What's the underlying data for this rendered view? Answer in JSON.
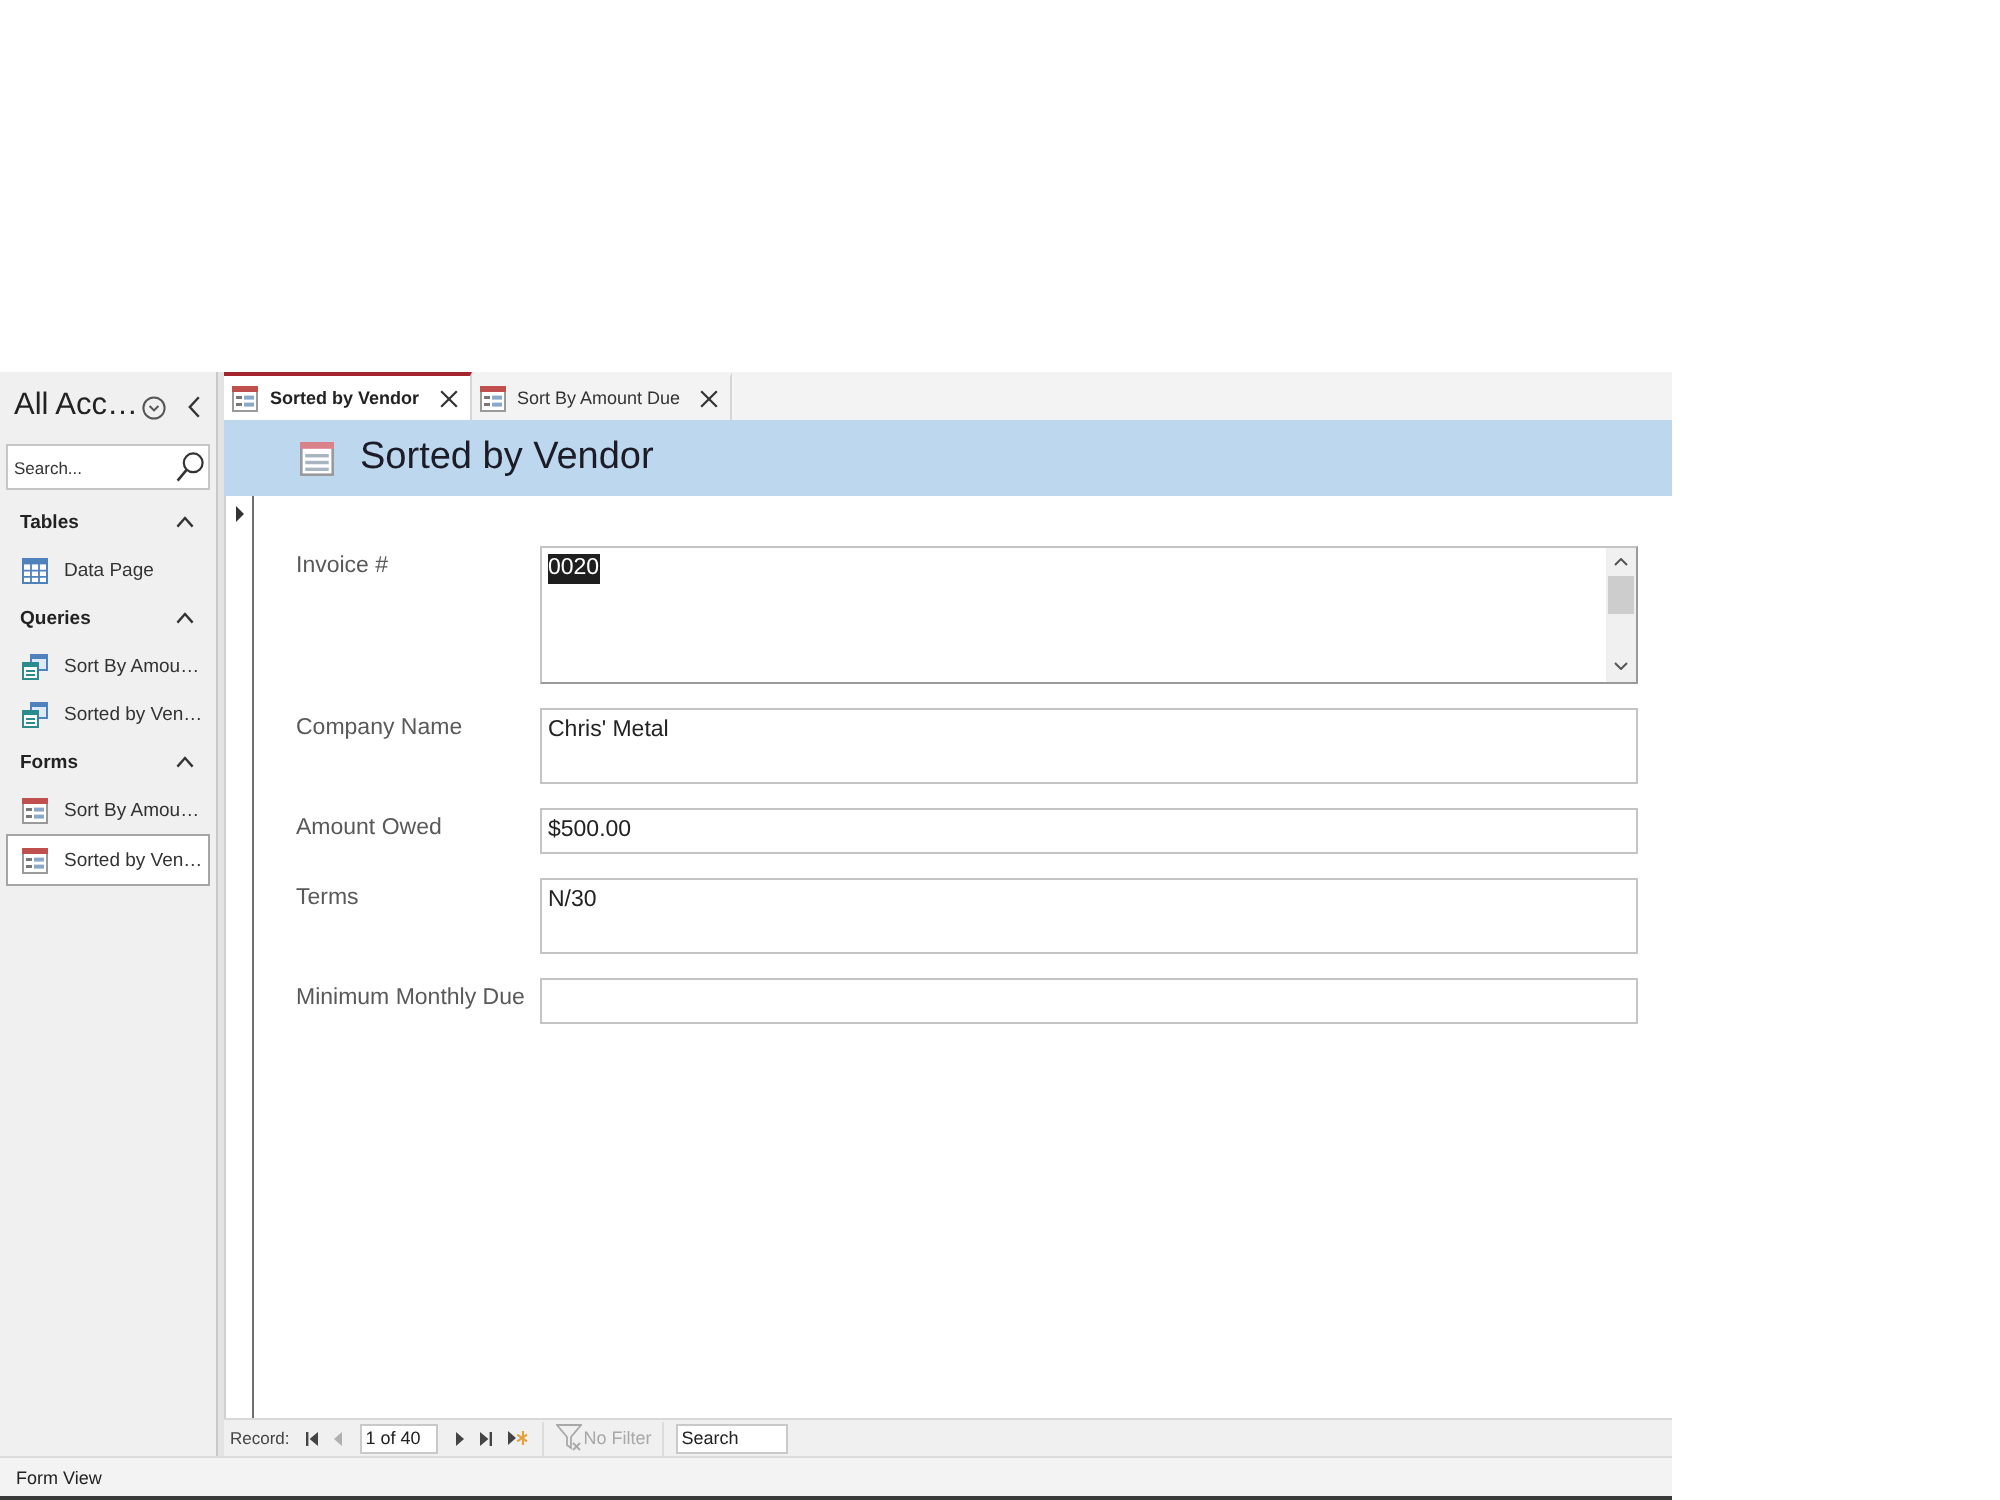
{
  "navigation_pane": {
    "title": "All Acc…",
    "search": {
      "placeholder": "Search..."
    },
    "groups": [
      {
        "label": "Tables",
        "expanded": true,
        "items": [
          {
            "label": "Data Page",
            "kind": "table",
            "selected": false
          }
        ]
      },
      {
        "label": "Queries",
        "expanded": true,
        "items": [
          {
            "label": "Sort By Amou…",
            "kind": "query",
            "selected": false
          },
          {
            "label": "Sorted by Ven…",
            "kind": "query",
            "selected": false
          }
        ]
      },
      {
        "label": "Forms",
        "expanded": true,
        "items": [
          {
            "label": "Sort By Amou…",
            "kind": "form",
            "selected": false
          },
          {
            "label": "Sorted by Ven…",
            "kind": "form",
            "selected": true
          }
        ]
      }
    ]
  },
  "tabs": [
    {
      "label": "Sorted by Vendor",
      "selected": true
    },
    {
      "label": "Sort By Amount Due",
      "selected": false
    }
  ],
  "form": {
    "title": "Sorted by Vendor",
    "fields": [
      {
        "label": "Invoice #",
        "kind": "memo",
        "value": "0020",
        "selected": true
      },
      {
        "label": "Company Name",
        "kind": "multiline",
        "value": "Chris' Metal",
        "selected": false
      },
      {
        "label": "Amount Owed",
        "kind": "single",
        "value": "$500.00",
        "selected": false
      },
      {
        "label": "Terms",
        "kind": "multiline",
        "value": "N/30",
        "selected": false
      },
      {
        "label": "Minimum Monthly Due",
        "kind": "single",
        "selected": false
      }
    ]
  },
  "record_navigation": {
    "label": "Record:",
    "buttons_before": [
      {
        "kind": "first",
        "disabled": false
      },
      {
        "kind": "previous",
        "disabled": true
      }
    ],
    "position": "1 of 40",
    "buttons_after": [
      {
        "kind": "next",
        "disabled": false
      },
      {
        "kind": "last",
        "disabled": false
      },
      {
        "kind": "new",
        "disabled": false
      }
    ],
    "filter": {
      "label": "No Filter",
      "disabled": true
    },
    "search": {
      "placeholder": "Search"
    }
  },
  "status_bar": {
    "text": "Form View"
  }
}
